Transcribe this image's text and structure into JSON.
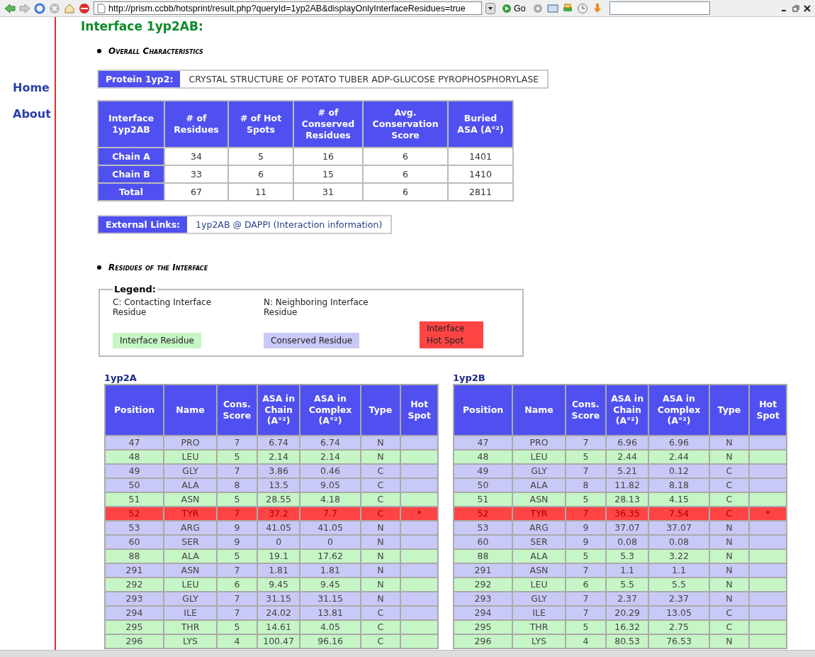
{
  "browser_toolbar": {
    "url": "http://prism.ccbb/hotsprint/result.php?queryId=1yp2AB&displayOnlyInterfaceResidues=true",
    "go_button": "Go"
  },
  "sidebar": {
    "items": [
      {
        "label": "Home"
      },
      {
        "label": "About"
      }
    ]
  },
  "title": "Interface 1yp2AB:",
  "overall": {
    "heading": "Overall Characteristics",
    "protein": {
      "label": "Protein 1yp2:",
      "value": "CRYSTAL STRUCTURE OF POTATO TUBER ADP-GLUCOSE PYROPHOSPHORYLASE"
    },
    "summary_table": {
      "columns": [
        "Interface 1yp2AB",
        "# of Residues",
        "# of Hot Spots",
        "# of Conserved Residues",
        "Avg. Conservation Score",
        "Buried ASA (A°²)"
      ],
      "rows": [
        [
          "Chain A",
          "34",
          "5",
          "16",
          "6",
          "1401"
        ],
        [
          "Chain B",
          "33",
          "6",
          "15",
          "6",
          "1410"
        ],
        [
          "Total",
          "67",
          "11",
          "31",
          "6",
          "2811"
        ]
      ]
    },
    "external_links": {
      "label": "External Links:",
      "link": "1yp2AB @ DAPPI (Interaction information)"
    }
  },
  "residues": {
    "heading": "Residues of the Interface",
    "legend": {
      "title": "Legend:",
      "notes": [
        "C: Contacting Interface Residue",
        "N: Neighboring Interface Residue"
      ],
      "swatches": [
        {
          "kind": "interface",
          "label": "Interface Residue"
        },
        {
          "kind": "conserved",
          "label": "Conserved Residue"
        },
        {
          "kind": "hotspot",
          "label": "Interface Hot Spot"
        }
      ]
    },
    "tables": [
      {
        "title": "1yp2A",
        "columns": [
          "Position",
          "Name",
          "Cons. Score",
          "ASA in Chain (A°²)",
          "ASA in Complex (A°²)",
          "Type",
          "Hot Spot"
        ],
        "rows": [
          {
            "kind": "conserved",
            "cells": [
              "47",
              "PRO",
              "7",
              "6.74",
              "6.74",
              "N",
              ""
            ]
          },
          {
            "kind": "interface",
            "cells": [
              "48",
              "LEU",
              "5",
              "2.14",
              "2.14",
              "N",
              ""
            ]
          },
          {
            "kind": "conserved",
            "cells": [
              "49",
              "GLY",
              "7",
              "3.86",
              "0.46",
              "C",
              ""
            ]
          },
          {
            "kind": "conserved",
            "cells": [
              "50",
              "ALA",
              "8",
              "13.5",
              "9.05",
              "C",
              ""
            ]
          },
          {
            "kind": "interface",
            "cells": [
              "51",
              "ASN",
              "5",
              "28.55",
              "4.18",
              "C",
              ""
            ]
          },
          {
            "kind": "hotspot",
            "cells": [
              "52",
              "TYR",
              "7",
              "37.2",
              "7.7",
              "C",
              "*"
            ]
          },
          {
            "kind": "conserved",
            "cells": [
              "53",
              "ARG",
              "9",
              "41.05",
              "41.05",
              "N",
              ""
            ]
          },
          {
            "kind": "conserved",
            "cells": [
              "60",
              "SER",
              "9",
              "0",
              "0",
              "N",
              ""
            ]
          },
          {
            "kind": "interface",
            "cells": [
              "88",
              "ALA",
              "5",
              "19.1",
              "17.62",
              "N",
              ""
            ]
          },
          {
            "kind": "conserved",
            "cells": [
              "291",
              "ASN",
              "7",
              "1.81",
              "1.81",
              "N",
              ""
            ]
          },
          {
            "kind": "interface",
            "cells": [
              "292",
              "LEU",
              "6",
              "9.45",
              "9.45",
              "N",
              ""
            ]
          },
          {
            "kind": "conserved",
            "cells": [
              "293",
              "GLY",
              "7",
              "31.15",
              "31.15",
              "N",
              ""
            ]
          },
          {
            "kind": "conserved",
            "cells": [
              "294",
              "ILE",
              "7",
              "24.02",
              "13.81",
              "C",
              ""
            ]
          },
          {
            "kind": "interface",
            "cells": [
              "295",
              "THR",
              "5",
              "14.61",
              "4.05",
              "C",
              ""
            ]
          },
          {
            "kind": "interface",
            "cells": [
              "296",
              "LYS",
              "4",
              "100.47",
              "96.16",
              "C",
              ""
            ]
          }
        ]
      },
      {
        "title": "1yp2B",
        "columns": [
          "Position",
          "Name",
          "Cons. Score",
          "ASA in Chain (A°²)",
          "ASA in Complex (A°²)",
          "Type",
          "Hot Spot"
        ],
        "rows": [
          {
            "kind": "conserved",
            "cells": [
              "47",
              "PRO",
              "7",
              "6.96",
              "6.96",
              "N",
              ""
            ]
          },
          {
            "kind": "interface",
            "cells": [
              "48",
              "LEU",
              "5",
              "2.44",
              "2.44",
              "N",
              ""
            ]
          },
          {
            "kind": "conserved",
            "cells": [
              "49",
              "GLY",
              "7",
              "5.21",
              "0.12",
              "C",
              ""
            ]
          },
          {
            "kind": "conserved",
            "cells": [
              "50",
              "ALA",
              "8",
              "11.82",
              "8.18",
              "C",
              ""
            ]
          },
          {
            "kind": "interface",
            "cells": [
              "51",
              "ASN",
              "5",
              "28.13",
              "4.15",
              "C",
              ""
            ]
          },
          {
            "kind": "hotspot",
            "cells": [
              "52",
              "TYR",
              "7",
              "36.35",
              "7.54",
              "C",
              "*"
            ]
          },
          {
            "kind": "conserved",
            "cells": [
              "53",
              "ARG",
              "9",
              "37.07",
              "37.07",
              "N",
              ""
            ]
          },
          {
            "kind": "conserved",
            "cells": [
              "60",
              "SER",
              "9",
              "0.08",
              "0.08",
              "N",
              ""
            ]
          },
          {
            "kind": "interface",
            "cells": [
              "88",
              "ALA",
              "5",
              "5.3",
              "3.22",
              "N",
              ""
            ]
          },
          {
            "kind": "conserved",
            "cells": [
              "291",
              "ASN",
              "7",
              "1.1",
              "1.1",
              "N",
              ""
            ]
          },
          {
            "kind": "interface",
            "cells": [
              "292",
              "LEU",
              "6",
              "5.5",
              "5.5",
              "N",
              ""
            ]
          },
          {
            "kind": "conserved",
            "cells": [
              "293",
              "GLY",
              "7",
              "2.37",
              "2.37",
              "N",
              ""
            ]
          },
          {
            "kind": "conserved",
            "cells": [
              "294",
              "ILE",
              "7",
              "20.29",
              "13.05",
              "C",
              ""
            ]
          },
          {
            "kind": "interface",
            "cells": [
              "295",
              "THR",
              "5",
              "16.32",
              "2.75",
              "C",
              ""
            ]
          },
          {
            "kind": "interface",
            "cells": [
              "296",
              "LYS",
              "4",
              "80.53",
              "76.53",
              "N",
              ""
            ]
          }
        ]
      }
    ]
  }
}
